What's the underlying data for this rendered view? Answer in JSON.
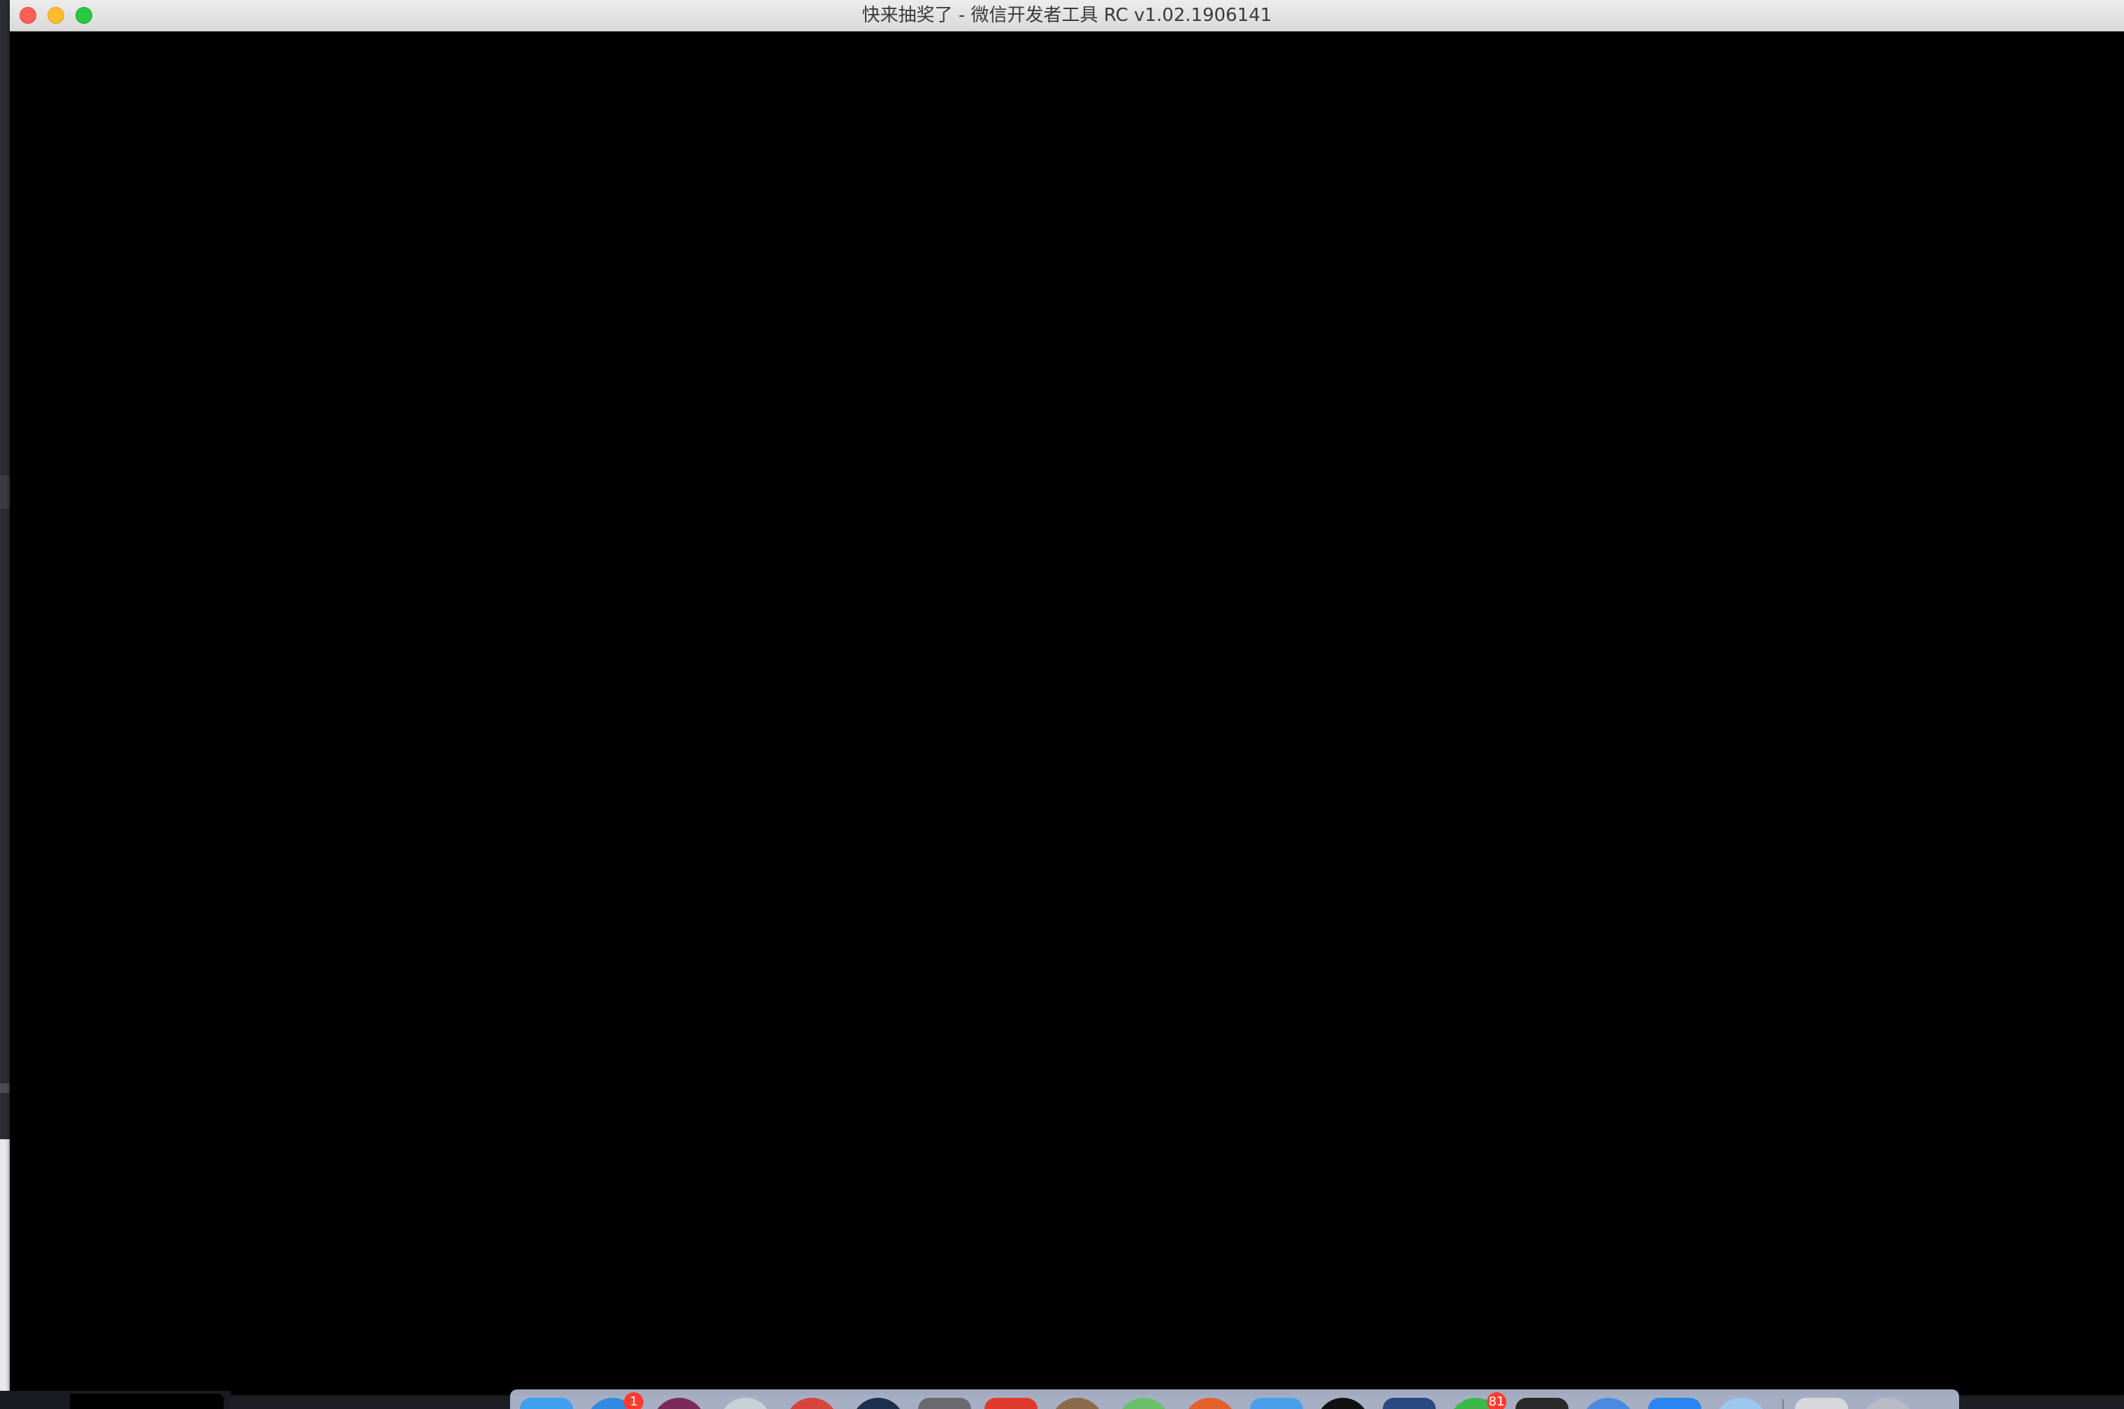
{
  "window": {
    "title": "快来抽奖了 - 微信开发者工具 RC v1.02.1906141"
  },
  "dock": {
    "items": [
      {
        "icon": "finder-icon",
        "color": "#3fa0f0"
      },
      {
        "icon": "safari-icon",
        "color": "#2f8ae0",
        "badge": "1"
      },
      {
        "icon": "app-purple-icon",
        "color": "#7a2a5a"
      },
      {
        "icon": "app-light-icon",
        "color": "#c8d0d8"
      },
      {
        "icon": "app-red-icon",
        "color": "#d6453a"
      },
      {
        "icon": "app-dark-circle-icon",
        "color": "#1c3050"
      },
      {
        "icon": "app-gray-icon",
        "color": "#6a6a70"
      },
      {
        "icon": "app-red-square-icon",
        "color": "#e03a2f"
      },
      {
        "icon": "app-stack-icon",
        "color": "#8a6a4a"
      },
      {
        "icon": "app-green-icon",
        "color": "#6ac06a"
      },
      {
        "icon": "app-orange-icon",
        "color": "#e2602a"
      },
      {
        "icon": "folder-icon",
        "color": "#4aa0e8"
      },
      {
        "icon": "app-black-x-icon",
        "color": "#111111"
      },
      {
        "icon": "app-blue-tools-icon",
        "color": "#2a4a80"
      },
      {
        "icon": "wechat-icon",
        "color": "#3cb84a",
        "badge": "81"
      },
      {
        "icon": "terminal-icon",
        "color": "#2a2a2a"
      },
      {
        "icon": "app-blue-arrow-icon",
        "color": "#4a8ae0"
      },
      {
        "icon": "app-store-icon",
        "color": "#2a86f0"
      },
      {
        "icon": "app-light-blue-icon",
        "color": "#9ac8f0"
      },
      {
        "icon": "preview-icon",
        "color": "#d8d8dc"
      },
      {
        "icon": "trash-icon",
        "color": "#b8bcc4"
      }
    ]
  }
}
